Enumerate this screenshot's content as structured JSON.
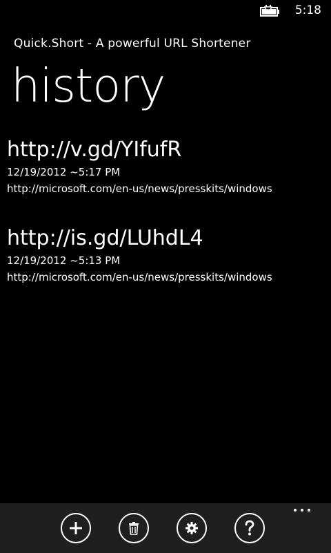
{
  "status_bar": {
    "time": "5:18",
    "battery_icon": "battery-charging-icon"
  },
  "header": {
    "app_title": "Quick.Short - A powerful URL Shortener",
    "page_title": "history"
  },
  "history": [
    {
      "short_url": "http://v.gd/YIfufR",
      "timestamp": "12/19/2012 ~5:17 PM",
      "long_url": "http://microsoft.com/en-us/news/presskits/windows"
    },
    {
      "short_url": "http://is.gd/LUhdL4",
      "timestamp": "12/19/2012 ~5:13 PM",
      "long_url": "http://microsoft.com/en-us/news/presskits/windows"
    }
  ],
  "app_bar": {
    "buttons": [
      {
        "icon": "add-icon"
      },
      {
        "icon": "delete-icon"
      },
      {
        "icon": "settings-icon"
      },
      {
        "icon": "help-icon"
      }
    ],
    "more_icon": "more-dots-icon"
  },
  "colors": {
    "background": "#000000",
    "foreground": "#ffffff",
    "app_bar": "#1f1f1f"
  }
}
